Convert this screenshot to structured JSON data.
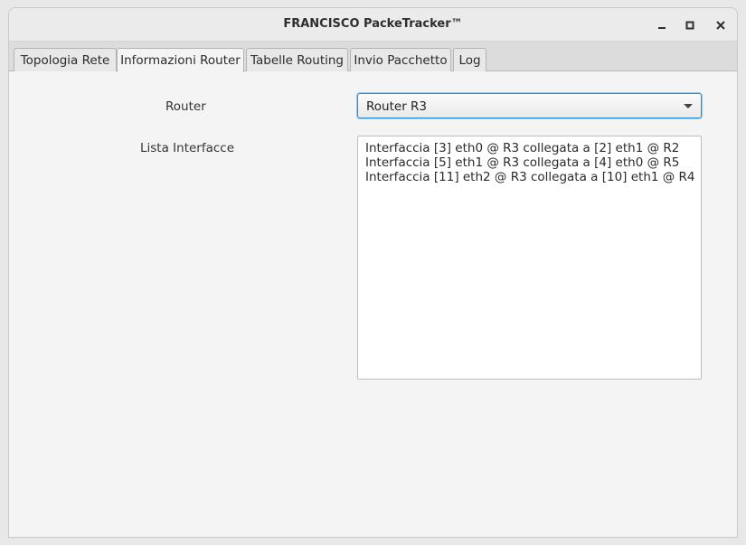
{
  "window": {
    "title": "FRANCISCO PackeTracker™",
    "minimize": "–",
    "maximize": "□",
    "close": "✕"
  },
  "tabs": [
    {
      "label": "Topologia Rete",
      "active": false
    },
    {
      "label": "Informazioni Router",
      "active": true
    },
    {
      "label": "Tabelle Routing",
      "active": false
    },
    {
      "label": "Invio Pacchetto",
      "active": false
    },
    {
      "label": "Log",
      "active": false
    }
  ],
  "form": {
    "router_label": "Router",
    "router_selected": "Router R3",
    "interfaces_label": "Lista Interfacce",
    "interfaces": [
      "Interfaccia [3] eth0 @ R3 collegata a [2] eth1 @ R2",
      "Interfaccia [5] eth1 @ R3 collegata a [4] eth0 @ R5",
      "Interfaccia [11] eth2 @ R3 collegata a [10] eth1 @ R4"
    ]
  },
  "colors": {
    "focus_border": "#2a8dd4"
  }
}
